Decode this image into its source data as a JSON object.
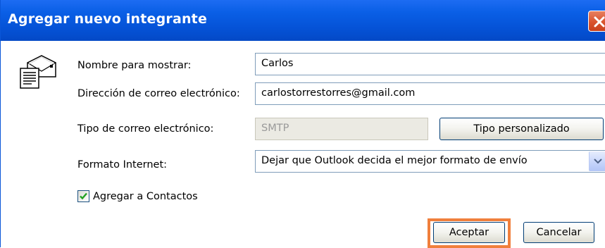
{
  "dialog": {
    "title": "Agregar nuevo integrante"
  },
  "fields": {
    "display_name_label": "Nombre para mostrar:",
    "display_name_value": "Carlos",
    "email_label": "Dirección de correo electrónico:",
    "email_value": "carlostorrestorres@gmail.com",
    "email_type_label": "Tipo de correo electrónico:",
    "email_type_value": "SMTP",
    "internet_format_label": "Formato Internet:",
    "internet_format_value": "Dejar que Outlook decida el mejor formato de envío"
  },
  "buttons": {
    "custom_type": "Tipo personalizado",
    "accept": "Aceptar",
    "cancel": "Cancelar"
  },
  "checkbox": {
    "label": "Agregar a Contactos",
    "checked": true
  },
  "colors": {
    "titlebar": "#0552d6",
    "highlight": "#f07f3c",
    "close": "#d9532e"
  },
  "icons": {
    "close": "close-icon",
    "envelope": "envelope-icon",
    "dropdown": "chevron-down-icon",
    "check": "check-icon"
  }
}
